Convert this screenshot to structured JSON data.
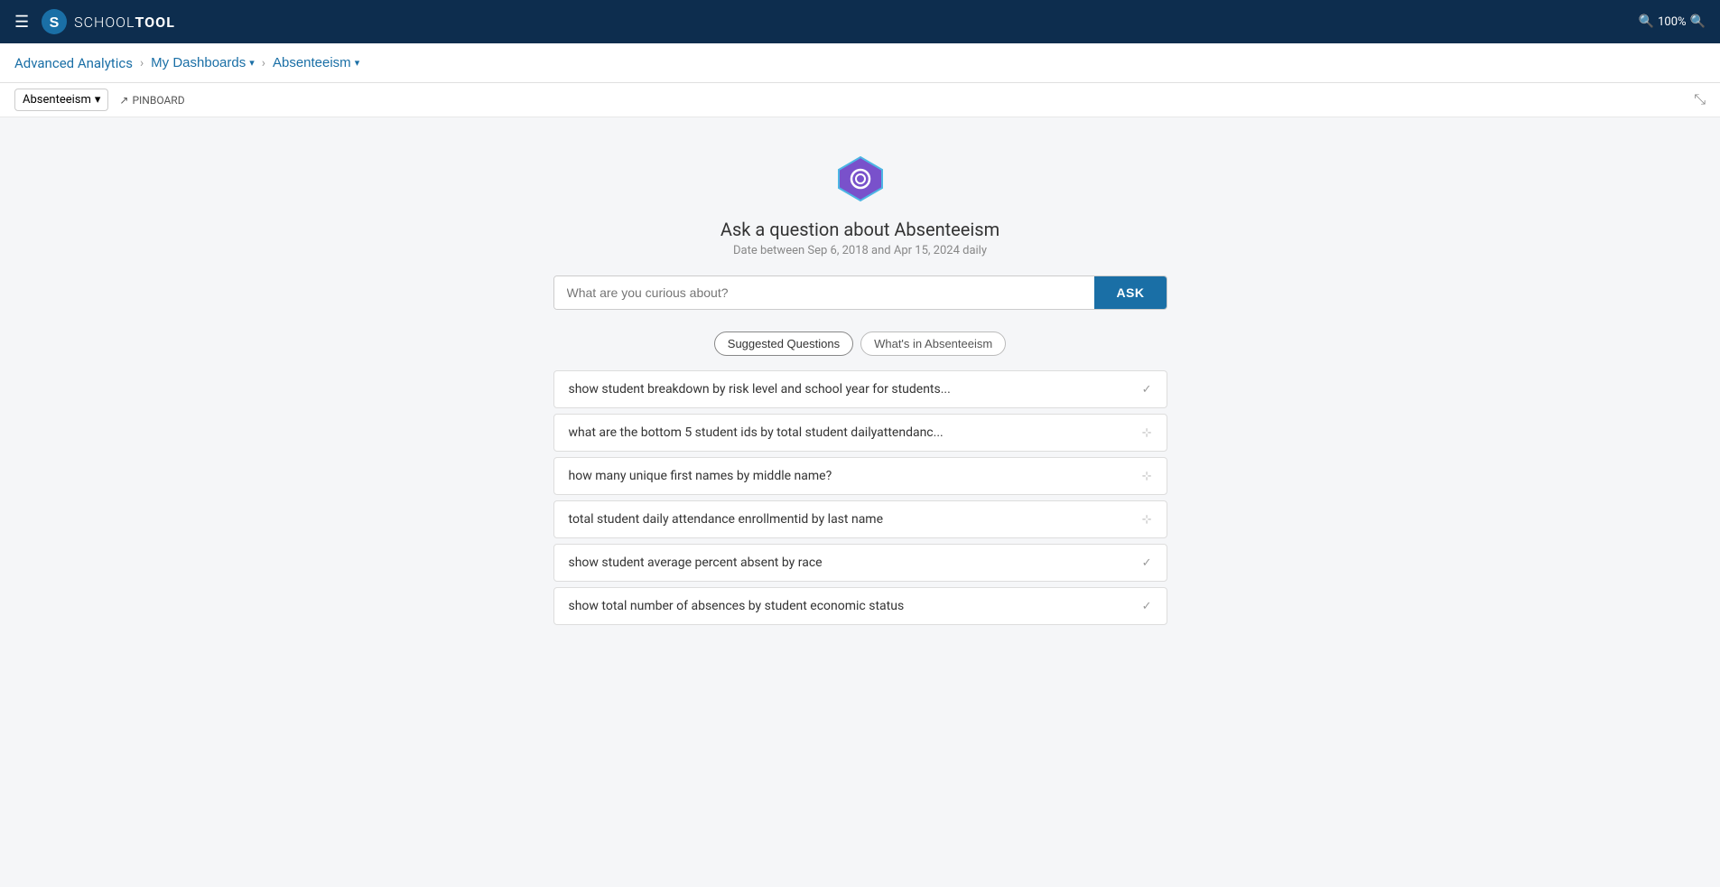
{
  "topbar": {
    "logo_letter": "S",
    "logo_text_light": "SCHOOL",
    "logo_text_bold": "TOOL",
    "zoom_label": "100%",
    "zoom_in": "🔍",
    "zoom_out": "🔍"
  },
  "breadcrumb": {
    "item1": "Advanced Analytics",
    "item2": "My Dashboards",
    "item3": "Absenteeism"
  },
  "toolbar": {
    "select_label": "Absenteeism",
    "pinboard_label": "PINBOARD"
  },
  "ask_panel": {
    "title": "Ask a question about Absenteeism",
    "subtitle": "Date between Sep 6, 2018 and Apr 15, 2024 daily",
    "input_placeholder": "What are you curious about?",
    "ask_button": "ASK"
  },
  "tabs": [
    {
      "label": "Suggested Questions",
      "active": true
    },
    {
      "label": "What's in Absenteeism",
      "active": false
    }
  ],
  "suggestions": [
    {
      "text": "show student breakdown by risk level and school year for students...",
      "icon": "check"
    },
    {
      "text": "what are the bottom 5 student ids by total student dailyattendanc...",
      "icon": "pin"
    },
    {
      "text": "how many unique first names by middle name?",
      "icon": "pin"
    },
    {
      "text": "total student daily attendance enrollmentid by last name",
      "icon": "pin"
    },
    {
      "text": "show student average percent absent by race",
      "icon": "check"
    },
    {
      "text": "show total number of absences by student economic status",
      "icon": "check"
    }
  ]
}
